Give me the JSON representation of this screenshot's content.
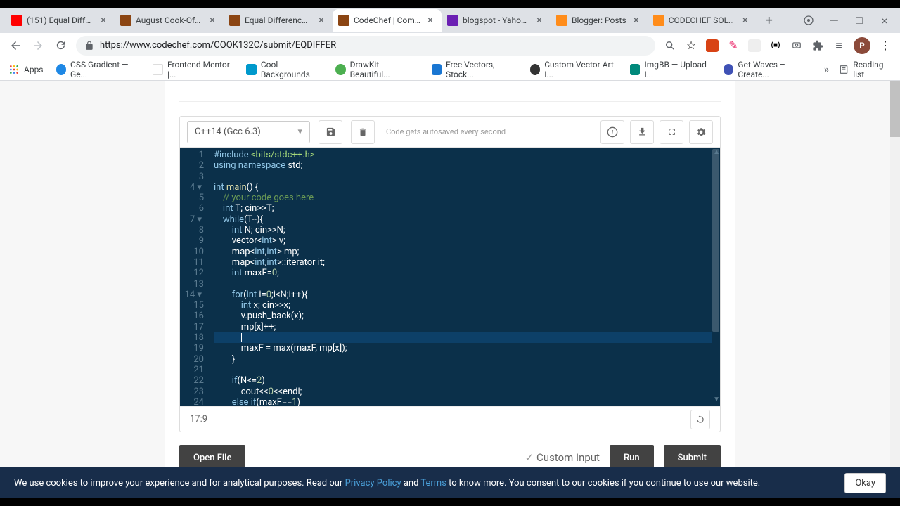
{
  "tabs": [
    {
      "title": "(151) Equal Difference",
      "icon": "#ff0000"
    },
    {
      "title": "August Cook-Off 202",
      "icon": "#8b4513"
    },
    {
      "title": "Equal Difference | Cod",
      "icon": "#8b4513"
    },
    {
      "title": "CodeChef | Competiti",
      "icon": "#8b4513",
      "active": true
    },
    {
      "title": "blogspot - Yahoo Sea",
      "icon": "#6b1fb3"
    },
    {
      "title": "Blogger: Posts",
      "icon": "#ff8c1a"
    },
    {
      "title": "CODECHEF SOLUTION",
      "icon": "#ff8c1a"
    }
  ],
  "url": "https://www.codechef.com/COOK132C/submit/EQDIFFER",
  "bookmarks": [
    {
      "label": "Apps",
      "icon": "apps"
    },
    {
      "label": "CSS Gradient — Ge...",
      "color": "#1e88e5"
    },
    {
      "label": "Frontend Mentor |...",
      "color": "#fff"
    },
    {
      "label": "Cool Backgrounds",
      "color": "#0099cc"
    },
    {
      "label": "DrawKit - Beautiful...",
      "color": "#4caf50"
    },
    {
      "label": "Free Vectors, Stock...",
      "color": "#1976d2"
    },
    {
      "label": "Custom Vector Art I...",
      "color": "#333"
    },
    {
      "label": "ImgBB — Upload I...",
      "color": "#00897b"
    },
    {
      "label": "Get Waves – Create...",
      "color": "#3f51b5"
    }
  ],
  "reading_list": "Reading list",
  "editor": {
    "language": "C++14 (Gcc 6.3)",
    "autosave": "Code gets autosaved every second",
    "status": "17:9"
  },
  "code_lines": [
    "#include <bits/stdc++.h>",
    "using namespace std;",
    "",
    "int main() {",
    "    // your code goes here",
    "    int T; cin>>T;",
    "    while(T--){",
    "        int N; cin>>N;",
    "        vector<int> v;",
    "        map<int,int> mp;",
    "        map<int,int>::iterator it;",
    "        int maxF=0;",
    "        ",
    "        for(int i=0;i<N;i++){",
    "            int x; cin>>x;",
    "            v.push_back(x);",
    "            mp[x]++;",
    "            ",
    "            maxF = max(maxF, mp[x]);",
    "        }",
    "        ",
    "        if(N<=2)",
    "            cout<<0<<endl;",
    "        else if(maxF==1)"
  ],
  "buttons": {
    "open_file": "Open File",
    "custom_input": "Custom Input",
    "run": "Run",
    "submit": "Submit"
  },
  "cookie": {
    "text1": "We use cookies to improve your experience and for analytical purposes. Read our ",
    "privacy": "Privacy Policy",
    "and": " and ",
    "terms": "Terms",
    "text2": " to know more. You consent to our cookies if you continue to use our website.",
    "ok": "Okay"
  },
  "avatar": "P"
}
